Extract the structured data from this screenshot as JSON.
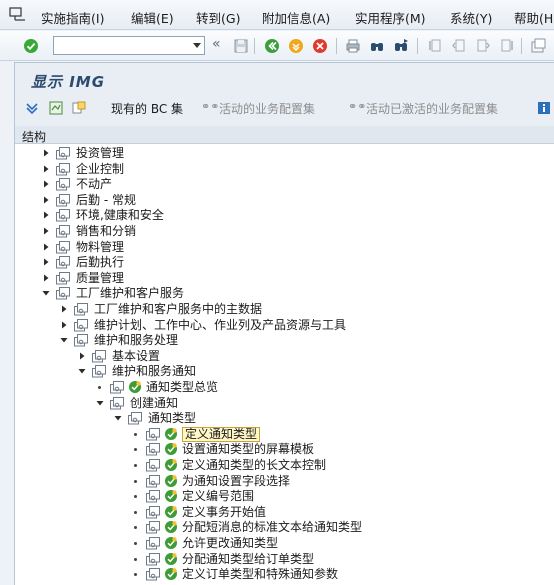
{
  "menu": {
    "items": [
      "实施指南(I)",
      "编辑(E)",
      "转到(G)",
      "附加信息(A)",
      "实用程序(M)",
      "系统(Y)",
      "帮助(H)"
    ]
  },
  "toolbar": {
    "command_value": "",
    "icons": [
      "enter-icon",
      "back-icon",
      "exit-icon",
      "cancel-icon",
      "print-icon",
      "find-icon",
      "find-next-icon",
      "first-page-icon",
      "prev-page-icon",
      "next-page-icon",
      "last-page-icon",
      "new-session-icon"
    ]
  },
  "header": {
    "title": "显示 IMG"
  },
  "app_toolbar": {
    "bc_sets": "现有的 BC 集",
    "active_bc": "活动的业务配置集",
    "activated_bc": "活动已激活的业务配置集"
  },
  "structure": {
    "heading": "结构",
    "nodes": [
      {
        "level": 0,
        "kind": "closed",
        "label": "投资管理"
      },
      {
        "level": 0,
        "kind": "closed",
        "label": "企业控制"
      },
      {
        "level": 0,
        "kind": "closed",
        "label": "不动产"
      },
      {
        "level": 0,
        "kind": "closed",
        "label": "后勤 - 常规"
      },
      {
        "level": 0,
        "kind": "closed",
        "label": "环境,健康和安全"
      },
      {
        "level": 0,
        "kind": "closed",
        "label": "销售和分销"
      },
      {
        "level": 0,
        "kind": "closed",
        "label": "物料管理"
      },
      {
        "level": 0,
        "kind": "closed",
        "label": "后勤执行"
      },
      {
        "level": 0,
        "kind": "closed",
        "label": "质量管理"
      },
      {
        "level": 0,
        "kind": "open",
        "label": "工厂维护和客户服务"
      },
      {
        "level": 1,
        "kind": "closed",
        "label": "工厂维护和客户服务中的主数据"
      },
      {
        "level": 1,
        "kind": "closed",
        "label": "维护计划、工作中心、作业列及产品资源与工具"
      },
      {
        "level": 1,
        "kind": "open",
        "label": "维护和服务处理"
      },
      {
        "level": 2,
        "kind": "closed",
        "label": "基本设置"
      },
      {
        "level": 2,
        "kind": "open",
        "label": "维护和服务通知"
      },
      {
        "level": 3,
        "kind": "leaf",
        "label": "通知类型总览",
        "exec": true
      },
      {
        "level": 3,
        "kind": "open",
        "label": "创建通知"
      },
      {
        "level": 4,
        "kind": "open",
        "label": "通知类型"
      },
      {
        "level": 5,
        "kind": "leaf",
        "label": "定义通知类型",
        "exec": true,
        "selected": true
      },
      {
        "level": 5,
        "kind": "leaf",
        "label": "设置通知类型的屏幕模板",
        "exec": true
      },
      {
        "level": 5,
        "kind": "leaf",
        "label": "定义通知类型的长文本控制",
        "exec": true
      },
      {
        "level": 5,
        "kind": "leaf",
        "label": "为通知设置字段选择",
        "exec": true
      },
      {
        "level": 5,
        "kind": "leaf",
        "label": "定义编号范围",
        "exec": true
      },
      {
        "level": 5,
        "kind": "leaf",
        "label": "定义事务开始值",
        "exec": true
      },
      {
        "level": 5,
        "kind": "leaf",
        "label": "分配短消息的标准文本给通知类型",
        "exec": true
      },
      {
        "level": 5,
        "kind": "leaf",
        "label": "允许更改通知类型",
        "exec": true
      },
      {
        "level": 5,
        "kind": "leaf",
        "label": "分配通知类型给订单类型",
        "exec": true
      },
      {
        "level": 5,
        "kind": "leaf",
        "label": "定义订单类型和特殊通知参数",
        "exec": true
      }
    ]
  }
}
